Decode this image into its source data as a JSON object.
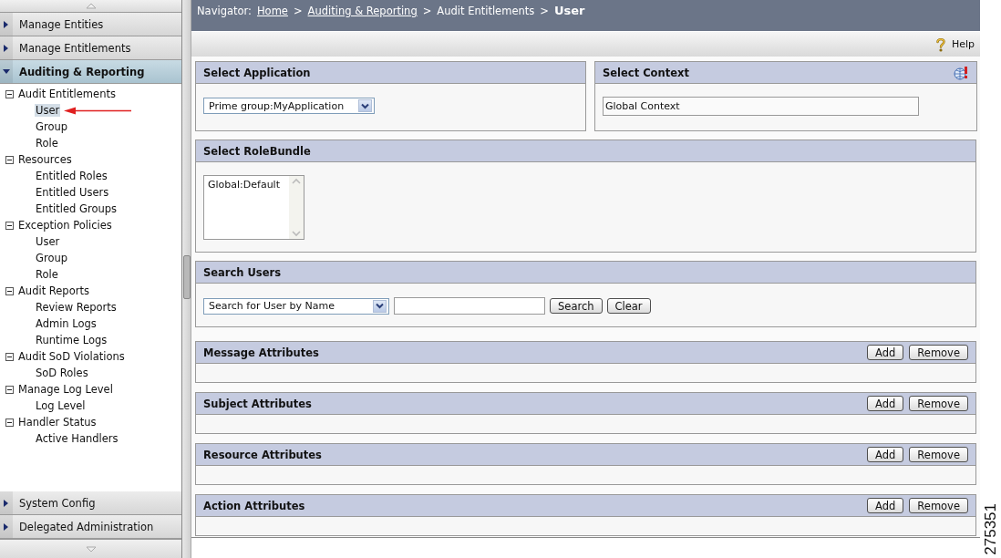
{
  "sidebar": {
    "sections_top": [
      {
        "label": "Manage Entities",
        "expanded": false
      },
      {
        "label": "Manage Entitlements",
        "expanded": false
      },
      {
        "label": "Auditing & Reporting",
        "expanded": true
      }
    ],
    "tree": [
      {
        "label": "Audit Entitlements",
        "expanded": true,
        "children": [
          {
            "label": "User",
            "selected": true
          },
          {
            "label": "Group",
            "selected": false
          },
          {
            "label": "Role",
            "selected": false
          }
        ]
      },
      {
        "label": "Resources",
        "expanded": true,
        "children": [
          {
            "label": "Entitled Roles",
            "selected": false
          },
          {
            "label": "Entitled Users",
            "selected": false
          },
          {
            "label": "Entitled Groups",
            "selected": false
          }
        ]
      },
      {
        "label": "Exception Policies",
        "expanded": true,
        "children": [
          {
            "label": "User",
            "selected": false
          },
          {
            "label": "Group",
            "selected": false
          },
          {
            "label": "Role",
            "selected": false
          }
        ]
      },
      {
        "label": "Audit Reports",
        "expanded": true,
        "children": [
          {
            "label": "Review Reports",
            "selected": false
          },
          {
            "label": "Admin Logs",
            "selected": false
          },
          {
            "label": "Runtime Logs",
            "selected": false
          }
        ]
      },
      {
        "label": "Audit SoD Violations",
        "expanded": true,
        "children": [
          {
            "label": "SoD Roles",
            "selected": false
          }
        ]
      },
      {
        "label": "Manage Log Level",
        "expanded": true,
        "children": [
          {
            "label": "Log Level",
            "selected": false
          }
        ]
      },
      {
        "label": "Handler Status",
        "expanded": true,
        "children": [
          {
            "label": "Active Handlers",
            "selected": false
          }
        ]
      }
    ],
    "sections_bottom": [
      {
        "label": "System Config",
        "expanded": false
      },
      {
        "label": "Delegated Administration",
        "expanded": false
      }
    ]
  },
  "navigator": [
    {
      "kind": "label",
      "text": "Navigator:"
    },
    {
      "kind": "link",
      "text": "Home"
    },
    {
      "kind": "separator",
      "text": ">"
    },
    {
      "kind": "link",
      "text": "Auditing & Reporting"
    },
    {
      "kind": "separator",
      "text": ">"
    },
    {
      "kind": "text",
      "text": "Audit Entitlements"
    },
    {
      "kind": "separator",
      "text": ">"
    },
    {
      "kind": "current",
      "text": "User"
    }
  ],
  "help": "Help",
  "select_application": {
    "title": "Select Application",
    "value": "Prime group:MyApplication"
  },
  "select_context": {
    "title": "Select Context",
    "value": "Global Context"
  },
  "select_rolebundle": {
    "title": "Select RoleBundle",
    "options": [
      {
        "label": "Global:Default",
        "selected": false
      }
    ]
  },
  "search_users": {
    "title": "Search Users",
    "criteria": "Search for User by Name",
    "buttons": [
      "Search",
      "Clear"
    ]
  },
  "attribute_panels": [
    {
      "title": "Message Attributes",
      "buttons": [
        "Add",
        "Remove"
      ]
    },
    {
      "title": "Subject Attributes",
      "buttons": [
        "Add",
        "Remove"
      ]
    },
    {
      "title": "Resource Attributes",
      "buttons": [
        "Add",
        "Remove"
      ]
    },
    {
      "title": "Action Attributes",
      "buttons": [
        "Add",
        "Remove"
      ]
    }
  ],
  "figure_number": "275351"
}
